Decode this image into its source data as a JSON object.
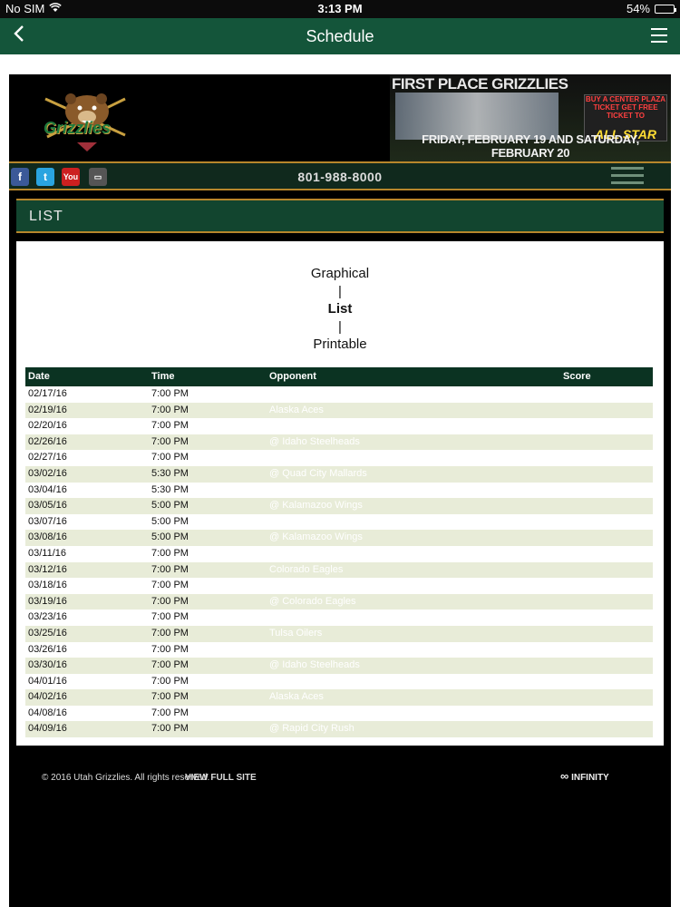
{
  "status_bar": {
    "carrier": "No SIM",
    "time": "3:13 PM",
    "battery_text": "54%",
    "battery_level": 0.54
  },
  "nav_bar": {
    "title": "Schedule"
  },
  "header": {
    "logo_text": "Grizzlies",
    "banner": {
      "headline": "FIRST PLACE GRIZZLIES",
      "dates": "FRIDAY, FEBRUARY 19 AND SATURDAY, FEBRUARY 20",
      "promo_brand": "ALL STAR",
      "promo_line": "BUY A CENTER PLAZA TICKET GET FREE TICKET TO"
    }
  },
  "social": {
    "phone": "801-988-8000",
    "icons": [
      "facebook-icon",
      "twitter-icon",
      "youtube-icon",
      "ticket-icon"
    ]
  },
  "section": {
    "title": "LIST"
  },
  "view_options": {
    "graphical": "Graphical",
    "separator": "|",
    "list": "List",
    "printable": "Printable",
    "selected": "List"
  },
  "table": {
    "headers": {
      "date": "Date",
      "time": "Time",
      "opponent": "Opponent",
      "score": "Score"
    },
    "rows": [
      {
        "date": "02/17/16",
        "time": "7:00 PM",
        "opponent": ""
      },
      {
        "date": "02/19/16",
        "time": "7:00 PM",
        "opponent": "Alaska Aces"
      },
      {
        "date": "02/20/16",
        "time": "7:00 PM",
        "opponent": ""
      },
      {
        "date": "02/26/16",
        "time": "7:00 PM",
        "opponent": "@ Idaho Steelheads"
      },
      {
        "date": "02/27/16",
        "time": "7:00 PM",
        "opponent": ""
      },
      {
        "date": "03/02/16",
        "time": "5:30 PM",
        "opponent": "@ Quad City Mallards"
      },
      {
        "date": "03/04/16",
        "time": "5:30 PM",
        "opponent": ""
      },
      {
        "date": "03/05/16",
        "time": "5:00 PM",
        "opponent": "@ Kalamazoo Wings"
      },
      {
        "date": "03/07/16",
        "time": "5:00 PM",
        "opponent": ""
      },
      {
        "date": "03/08/16",
        "time": "5:00 PM",
        "opponent": "@ Kalamazoo Wings"
      },
      {
        "date": "03/11/16",
        "time": "7:00 PM",
        "opponent": ""
      },
      {
        "date": "03/12/16",
        "time": "7:00 PM",
        "opponent": "Colorado Eagles"
      },
      {
        "date": "03/18/16",
        "time": "7:00 PM",
        "opponent": ""
      },
      {
        "date": "03/19/16",
        "time": "7:00 PM",
        "opponent": "@ Colorado Eagles"
      },
      {
        "date": "03/23/16",
        "time": "7:00 PM",
        "opponent": ""
      },
      {
        "date": "03/25/16",
        "time": "7:00 PM",
        "opponent": "Tulsa Oilers"
      },
      {
        "date": "03/26/16",
        "time": "7:00 PM",
        "opponent": ""
      },
      {
        "date": "03/30/16",
        "time": "7:00 PM",
        "opponent": "@ Idaho Steelheads"
      },
      {
        "date": "04/01/16",
        "time": "7:00 PM",
        "opponent": ""
      },
      {
        "date": "04/02/16",
        "time": "7:00 PM",
        "opponent": "Alaska Aces"
      },
      {
        "date": "04/08/16",
        "time": "7:00 PM",
        "opponent": ""
      },
      {
        "date": "04/09/16",
        "time": "7:00 PM",
        "opponent": "@ Rapid City Rush"
      }
    ]
  },
  "footer": {
    "copyright": "© 2016 Utah Grizzlies. All rights reserved.",
    "full_site": "VIEW FULL SITE",
    "sponsor": "INFINITY"
  },
  "colors": {
    "nav_green": "#14553a",
    "accent_gold": "#b7862b",
    "table_header": "#0b3322",
    "row_alt": "#e8ecd8"
  }
}
